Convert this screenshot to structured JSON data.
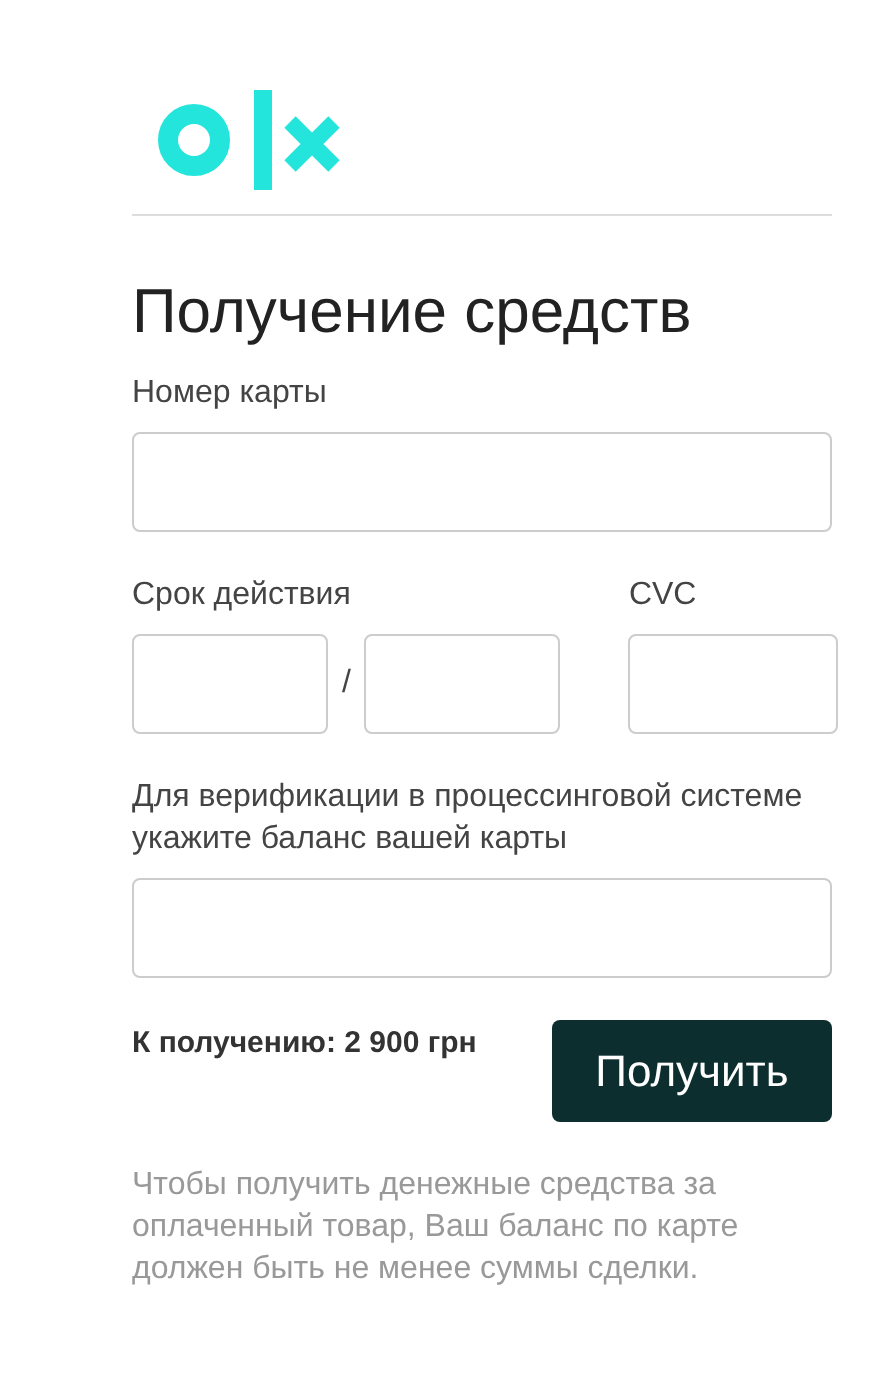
{
  "title": "Получение средств",
  "fields": [
    {
      "kind": "wide",
      "label": "Номер карты"
    },
    {
      "kind": "expiry",
      "label": "Срок действия",
      "separator": "/"
    },
    {
      "kind": "cvc",
      "label": "CVC"
    },
    {
      "kind": "wide",
      "label": "Для верификации в процессинговой системе укажите баланс вашей карты"
    }
  ],
  "amount": "К получению: 2 900 грн",
  "submit": "Получить",
  "note": "Чтобы получить денежные средства за оплаченный товар, Ваш баланс по карте должен быть не менее суммы сделки."
}
